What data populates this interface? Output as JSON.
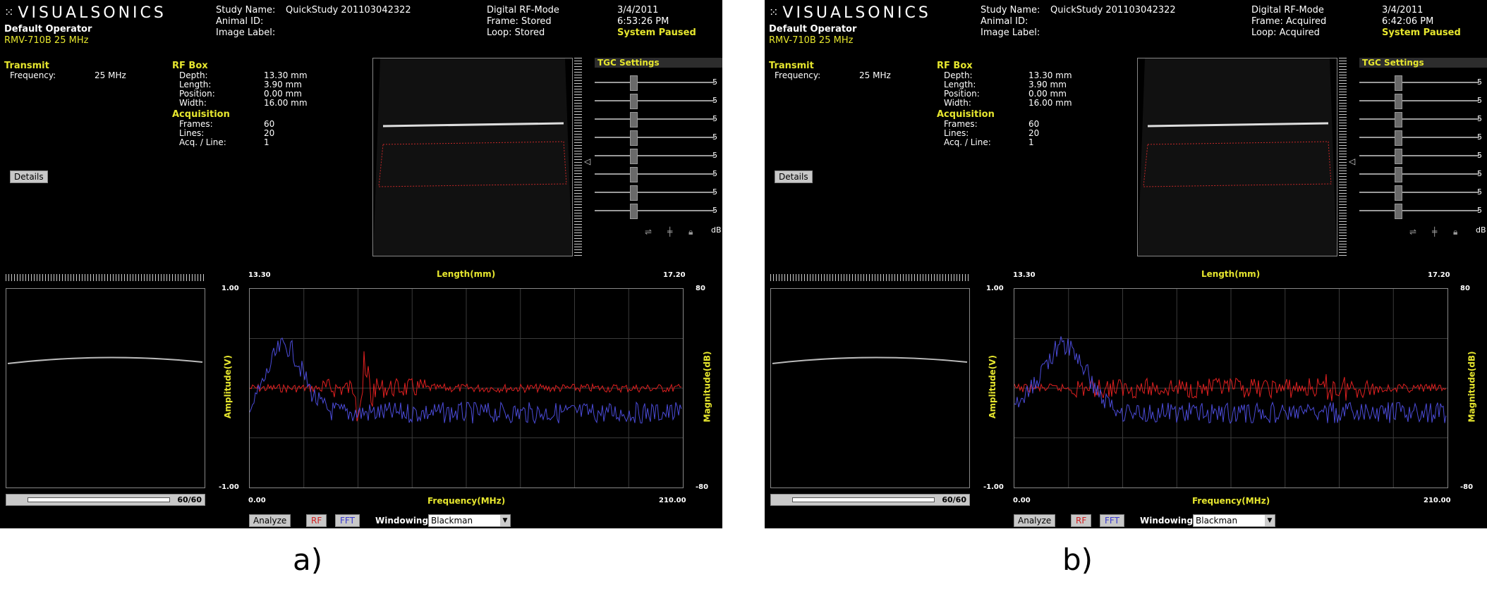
{
  "panels": [
    {
      "brand": "VISUALSONICS",
      "operator": "Default Operator",
      "probe": "RMV-710B  25 MHz",
      "study_name_label": "Study Name:",
      "study_name": "QuickStudy 201103042322",
      "animal_id_label": "Animal ID:",
      "image_label_label": "Image Label:",
      "mode": "Digital RF-Mode",
      "frame": "Frame: Stored",
      "loop": "Loop: Stored",
      "date": "3/4/2011",
      "time": "6:53:26 PM",
      "status": "System Paused",
      "transmit_title": "Transmit",
      "frequency_label": "Frequency:",
      "frequency_value": "25 MHz",
      "rfbox_title": "RF Box",
      "depth_label": "Depth:",
      "depth_value": "13.30 mm",
      "length_label": "Length:",
      "length_value": "3.90 mm",
      "position_label": "Position:",
      "position_value": "0.00 mm",
      "width_label": "Width:",
      "width_value": "16.00 mm",
      "acq_title": "Acquisition",
      "frames_label": "Frames:",
      "frames_value": "60",
      "lines_label": "Lines:",
      "lines_value": "20",
      "acqline_label": "Acq. / Line:",
      "acqline_value": "1",
      "details_button": "Details",
      "tgc_title": "TGC Settings",
      "tgc_values": [
        "5",
        "5",
        "5",
        "5",
        "5",
        "5",
        "5",
        "5"
      ],
      "tgc_unit": "dB",
      "chart_top_left": "13.30",
      "chart_top_title": "Length(mm)",
      "chart_top_right": "17.20",
      "chart_y_top": "1.00",
      "chart_y_bottom": "-1.00",
      "chart_y_right_top": "80",
      "chart_y_right_bottom": "-80",
      "chart_left_title": "Amplitude(V)",
      "chart_right_title": "Magnitude(dB)",
      "chart_bottom_left": "0.00",
      "chart_bottom_title": "Frequency(MHz)",
      "chart_bottom_right": "210.00",
      "frame_counter": "60/60",
      "analyze_button": "Analyze",
      "rf_toggle": "RF",
      "fft_toggle": "FFT",
      "windowing_label": "Windowing",
      "windowing_value": "Blackman",
      "caption": "a)"
    },
    {
      "brand": "VISUALSONICS",
      "operator": "Default Operator",
      "probe": "RMV-710B  25 MHz",
      "study_name_label": "Study Name:",
      "study_name": "QuickStudy 201103042322",
      "animal_id_label": "Animal ID:",
      "image_label_label": "Image Label:",
      "mode": "Digital RF-Mode",
      "frame": "Frame: Acquired",
      "loop": "Loop: Acquired",
      "date": "3/4/2011",
      "time": "6:42:06 PM",
      "status": "System Paused",
      "transmit_title": "Transmit",
      "frequency_label": "Frequency:",
      "frequency_value": "25 MHz",
      "rfbox_title": "RF Box",
      "depth_label": "Depth:",
      "depth_value": "13.30 mm",
      "length_label": "Length:",
      "length_value": "3.90 mm",
      "position_label": "Position:",
      "position_value": "0.00 mm",
      "width_label": "Width:",
      "width_value": "16.00 mm",
      "acq_title": "Acquisition",
      "frames_label": "Frames:",
      "frames_value": "60",
      "lines_label": "Lines:",
      "lines_value": "20",
      "acqline_label": "Acq. / Line:",
      "acqline_value": "1",
      "details_button": "Details",
      "tgc_title": "TGC Settings",
      "tgc_values": [
        "5",
        "5",
        "5",
        "5",
        "5",
        "5",
        "5",
        "5"
      ],
      "tgc_unit": "dB",
      "chart_top_left": "13.30",
      "chart_top_title": "Length(mm)",
      "chart_top_right": "17.20",
      "chart_y_top": "1.00",
      "chart_y_bottom": "-1.00",
      "chart_y_right_top": "80",
      "chart_y_right_bottom": "-80",
      "chart_left_title": "Amplitude(V)",
      "chart_right_title": "Magnitude(dB)",
      "chart_bottom_left": "0.00",
      "chart_bottom_title": "Frequency(MHz)",
      "chart_bottom_right": "210.00",
      "frame_counter": "60/60",
      "analyze_button": "Analyze",
      "rf_toggle": "RF",
      "fft_toggle": "FFT",
      "windowing_label": "Windowing",
      "windowing_value": "Blackman",
      "caption": "b)"
    }
  ],
  "colors": {
    "background": "#000000",
    "accent_yellow": "#e6e62e",
    "rf_trace": "#e02020",
    "fft_trace": "#4b4bd8",
    "grid": "#3a3a3a"
  }
}
